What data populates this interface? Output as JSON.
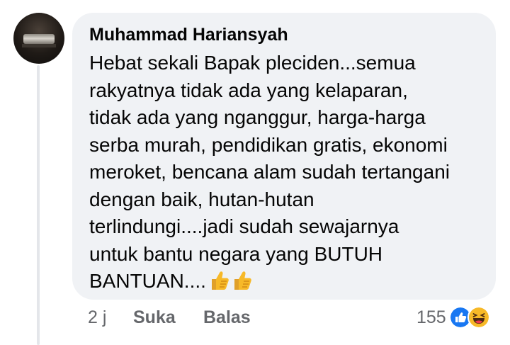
{
  "comment": {
    "author": "Muhammad Hariansyah",
    "lines": [
      "Hebat sekali Bapak pleciden...semua",
      "rakyatnya tidak ada yang kelaparan,",
      "tidak ada yang nganggur, harga-harga",
      "serba murah, pendidikan gratis, ekonomi",
      "meroket, bencana alam sudah tertangani",
      "dengan baik, hutan-hutan",
      "terlindungi....jadi sudah sewajarnya",
      "untuk bantu negara yang BUTUH",
      "BANTUAN...."
    ],
    "trailing_emoji": [
      "thumbs-up-icon",
      "thumbs-up-icon"
    ]
  },
  "footer": {
    "time": "2 j",
    "like_label": "Suka",
    "reply_label": "Balas",
    "reaction_count": "155",
    "reactions": [
      "like-reaction-icon",
      "haha-reaction-icon"
    ]
  },
  "colors": {
    "bubble": "#f0f2f5",
    "text": "#050505",
    "secondary": "#65676b",
    "like_blue": "#1877f2",
    "haha_yellow": "#f7b928"
  }
}
